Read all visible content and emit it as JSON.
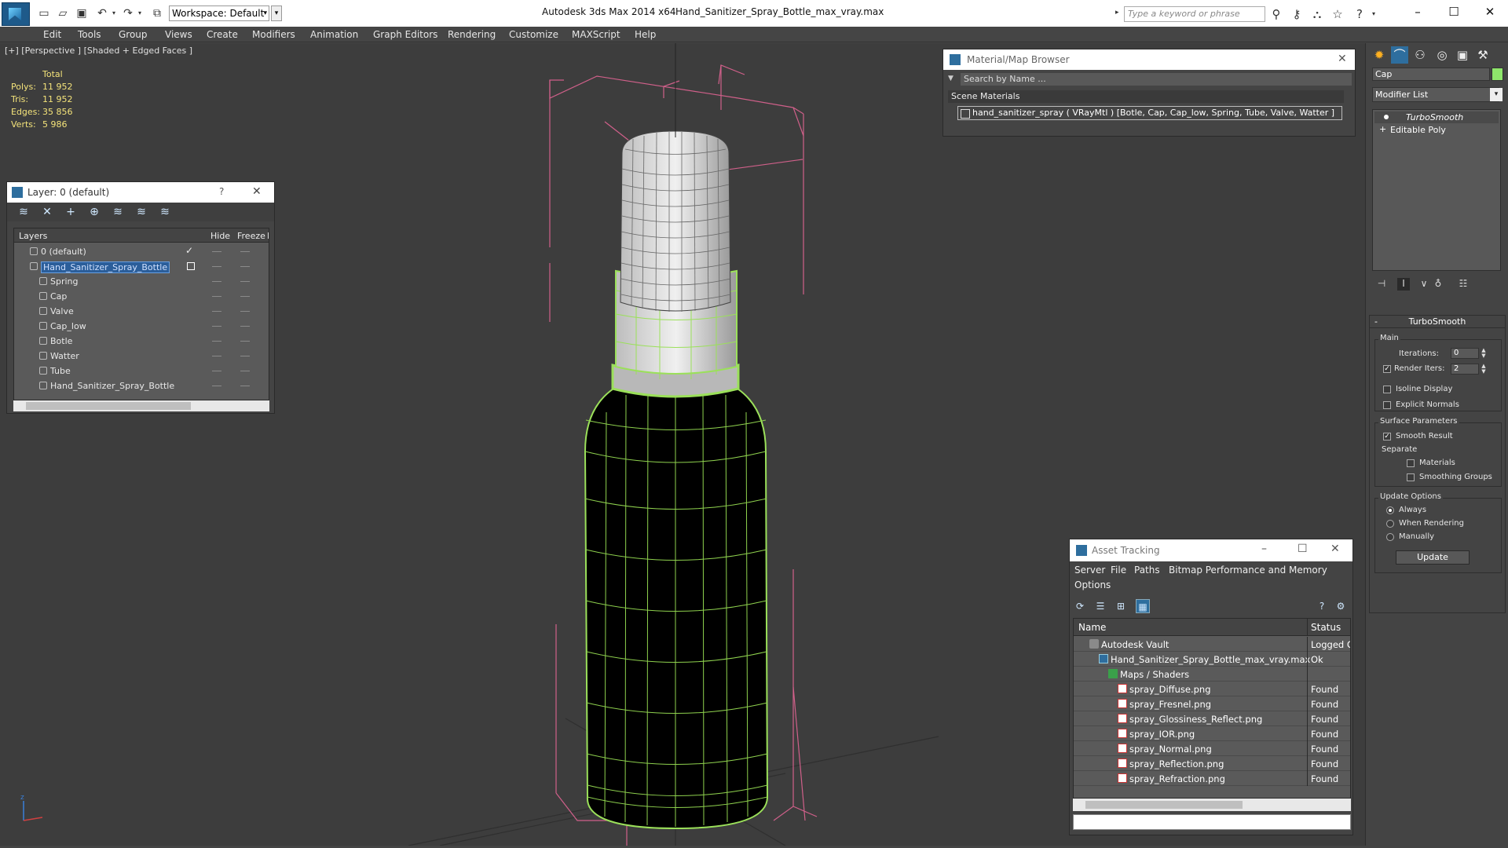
{
  "titlebar": {
    "workspace": "Workspace: Default",
    "app_title": "Autodesk 3ds Max  2014 x64",
    "file_title": "Hand_Sanitizer_Spray_Bottle_max_vray.max",
    "search_placeholder": "Type a keyword or phrase"
  },
  "menu": [
    "Edit",
    "Tools",
    "Group",
    "Views",
    "Create",
    "Modifiers",
    "Animation",
    "Graph Editors",
    "Rendering",
    "Customize",
    "MAXScript",
    "Help"
  ],
  "viewport": {
    "label": "[+] [Perspective ] [Shaded + Edged Faces ]",
    "stats": {
      "header": "Total",
      "rows": [
        {
          "label": "Polys:",
          "value": "11 952"
        },
        {
          "label": "Tris:",
          "value": "11 952"
        },
        {
          "label": "Edges:",
          "value": "35 856"
        },
        {
          "label": "Verts:",
          "value": "5 986"
        }
      ]
    }
  },
  "layer_window": {
    "title": "Layer: 0 (default)",
    "help": "?",
    "columns": [
      "Layers",
      "Hide",
      "Freeze",
      "R"
    ],
    "rows": [
      {
        "name": "0 (default)",
        "level": 0,
        "selected": false,
        "checked": true
      },
      {
        "name": "Hand_Sanitizer_Spray_Bottle",
        "level": 0,
        "selected": true,
        "checked": false
      },
      {
        "name": "Spring",
        "level": 1
      },
      {
        "name": "Cap",
        "level": 1
      },
      {
        "name": "Valve",
        "level": 1
      },
      {
        "name": "Cap_low",
        "level": 1
      },
      {
        "name": "Botle",
        "level": 1
      },
      {
        "name": "Watter",
        "level": 1
      },
      {
        "name": "Tube",
        "level": 1
      },
      {
        "name": "Hand_Sanitizer_Spray_Bottle",
        "level": 1
      }
    ]
  },
  "material_browser": {
    "title": "Material/Map Browser",
    "search_placeholder": "Search by Name ...",
    "section": "Scene Materials",
    "item": "hand_sanitizer_spray  ( VRayMtl )  [Botle, Cap, Cap_low, Spring, Tube, Valve, Watter ]"
  },
  "command_panel": {
    "object_name": "Cap",
    "object_color": "#8ee66b",
    "modifier_list": "Modifier List",
    "stack": [
      "TurboSmooth",
      "Editable Poly"
    ],
    "rollout_title": "TurboSmooth",
    "main_group": "Main",
    "iterations_label": "Iterations:",
    "iterations_value": "0",
    "render_iters_label": "Render Iters:",
    "render_iters_value": "2",
    "render_iters_checked": true,
    "isoline": "Isoline Display",
    "explicit_normals": "Explicit Normals",
    "surface_group": "Surface Parameters",
    "smooth_result": "Smooth Result",
    "separate": "Separate",
    "materials": "Materials",
    "smoothing_groups": "Smoothing Groups",
    "update_group": "Update Options",
    "always": "Always",
    "when_rendering": "When Rendering",
    "manually": "Manually",
    "update_button": "Update"
  },
  "asset_tracking": {
    "title": "Asset Tracking",
    "menu": [
      "Server",
      "File",
      "Paths",
      "Bitmap Performance and Memory",
      "Options"
    ],
    "columns": [
      "Name",
      "Status"
    ],
    "rows": [
      {
        "name": "Autodesk Vault",
        "status": "Logged O",
        "indent": 1,
        "icon": "vault-icon"
      },
      {
        "name": "Hand_Sanitizer_Spray_Bottle_max_vray.max",
        "status": "Ok",
        "indent": 2,
        "icon": "max-file-icon"
      },
      {
        "name": "Maps / Shaders",
        "status": "",
        "indent": 3,
        "icon": "maps-folder-icon"
      },
      {
        "name": "spray_Diffuse.png",
        "status": "Found",
        "indent": 4,
        "icon": "png-icon"
      },
      {
        "name": "spray_Fresnel.png",
        "status": "Found",
        "indent": 4,
        "icon": "png-icon"
      },
      {
        "name": "spray_Glossiness_Reflect.png",
        "status": "Found",
        "indent": 4,
        "icon": "png-icon"
      },
      {
        "name": "spray_IOR.png",
        "status": "Found",
        "indent": 4,
        "icon": "png-icon"
      },
      {
        "name": "spray_Normal.png",
        "status": "Found",
        "indent": 4,
        "icon": "png-icon"
      },
      {
        "name": "spray_Reflection.png",
        "status": "Found",
        "indent": 4,
        "icon": "png-icon"
      },
      {
        "name": "spray_Refraction.png",
        "status": "Found",
        "indent": 4,
        "icon": "png-icon"
      }
    ]
  }
}
